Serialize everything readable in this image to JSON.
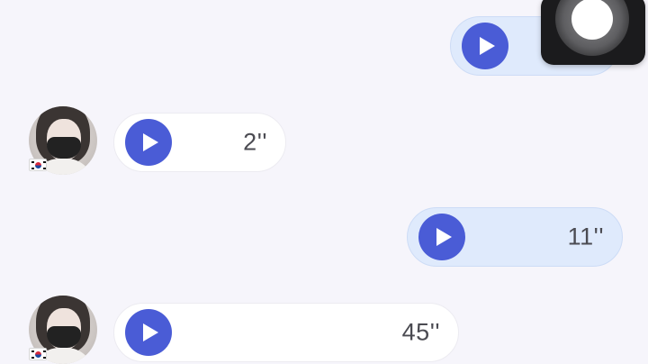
{
  "messages": [
    {
      "direction": "sent",
      "type": "voice",
      "duration": ""
    },
    {
      "direction": "received",
      "type": "voice",
      "duration": "2''",
      "avatar_flag": "korea-flag"
    },
    {
      "direction": "sent",
      "type": "voice",
      "duration": "11''"
    },
    {
      "direction": "received",
      "type": "voice",
      "duration": "45''",
      "avatar_flag": "korea-flag"
    }
  ],
  "icons": {
    "play": "play-icon",
    "assistive_touch": "assistive-touch-icon"
  },
  "colors": {
    "background": "#f6f5fb",
    "sent_bubble": "#dfeafc",
    "received_bubble": "#ffffff",
    "play_button": "#4a5cd6",
    "duration_text": "#4b4b52"
  }
}
